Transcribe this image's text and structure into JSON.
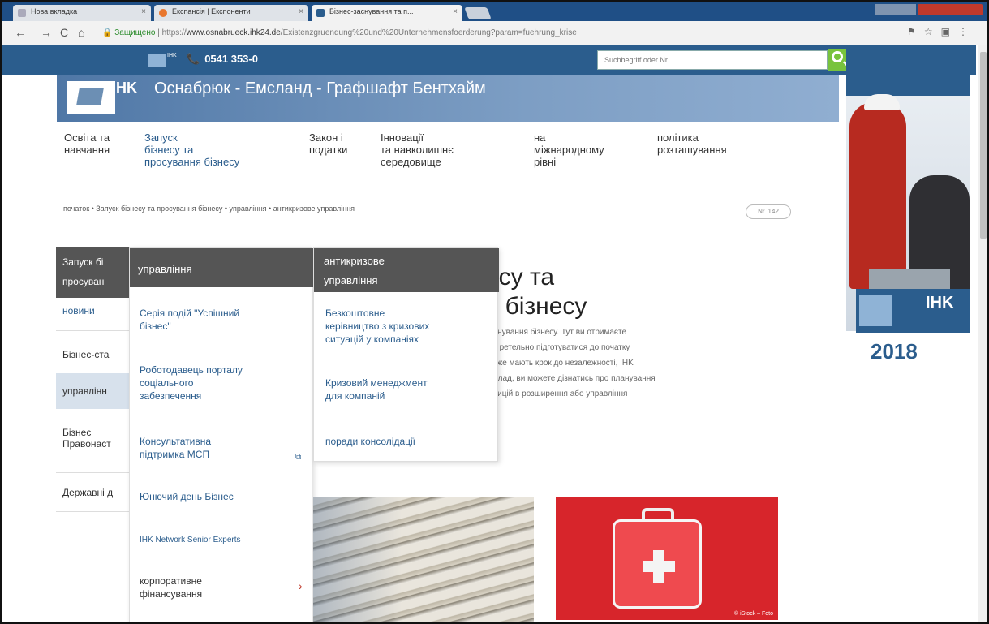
{
  "browser": {
    "tabs": [
      {
        "title": "Нова вкладка"
      },
      {
        "title": "Експансія | Експоненти"
      },
      {
        "title": "Бізнес-заснування та п..."
      }
    ],
    "url_secure_label": "Защищено",
    "url_prefix": "https://",
    "url_host": "www.osnabrueck.ihk24.de",
    "url_path": "/Existenzgruendung%20und%20Unternehmensfoerderung?param=fuehrung_krise"
  },
  "site": {
    "phone": "0541 353-0",
    "search_placeholder": "Suchbegriff oder Nr.",
    "banner_ihk": "IHK",
    "banner_title": "Оснабрюк - Емсланд - Графшафт Бентхайм",
    "logo_small_label": "IHK"
  },
  "nav": {
    "items": [
      {
        "line1": "Освіта та",
        "line2": "навчання",
        "line3": ""
      },
      {
        "line1": "Запуск",
        "line2": "бізнесу та",
        "line3": "просування бізнесу"
      },
      {
        "line1": "Закон і",
        "line2": "податки",
        "line3": ""
      },
      {
        "line1": "Інновації",
        "line2": "та навколишнє",
        "line3": "середовище"
      },
      {
        "line1": "на",
        "line2": "міжнародному",
        "line3": "рівні"
      },
      {
        "line1": "політика",
        "line2": "розташування",
        "line3": ""
      }
    ]
  },
  "breadcrumb": "початок • Запуск бізнесу та просування бізнесу • управління • антикризове управління",
  "page_badge": "Nr. 142",
  "heading": {
    "line1": "есу та",
    "line2": "я бізнесу"
  },
  "intro": {
    "l1": "заснування бізнесу. Тут ви отримаєте",
    "l2": "оги ретельно підготуватися до початку",
    "l3": "кі вже мають крок до незалежності, IHK",
    "l4": "риклад, ви можете дізнатись про планування",
    "l5": "естицій в розширення або управління"
  },
  "sidebar": {
    "head_line1": "Запуск бі",
    "head_line2": "просуван",
    "items": [
      "новини",
      "Бізнес-ста",
      "управлінн",
      "Бізнес",
      "Правонаст",
      "Державні д"
    ]
  },
  "dropdown2": {
    "head": "управління",
    "options": [
      {
        "l1": "Серія подій \"Успішний",
        "l2": "бізнес\""
      },
      {
        "l1": "Роботодавець порталу",
        "l2": "соціального",
        "l3": "забезпечення"
      },
      {
        "l1": "Консультативна",
        "l2": "підтримка МСП"
      },
      {
        "l1": "Юнючий день Бізнес"
      },
      {
        "l1": "IHK Network Senior Experts"
      },
      {
        "l1": "корпоративне",
        "l2": "фінансування"
      }
    ]
  },
  "dropdown3": {
    "head_l1": "антикризове",
    "head_l2": "управління",
    "options": [
      {
        "l1": "Безкоштовне",
        "l2": "керівництво з кризових",
        "l3": "ситуацій у компаніях"
      },
      {
        "l1": "Кризовий менеджмент",
        "l2": "для компаній"
      },
      {
        "l1": "поради консолідації"
      }
    ]
  },
  "ad": {
    "brand": "IHK",
    "year": "2018"
  },
  "images": {
    "kit_credit": "© iStock – Foto"
  },
  "colors": {
    "brand": "#2b5d8d",
    "accent_green": "#78c33d",
    "menu_dark": "#555555"
  }
}
